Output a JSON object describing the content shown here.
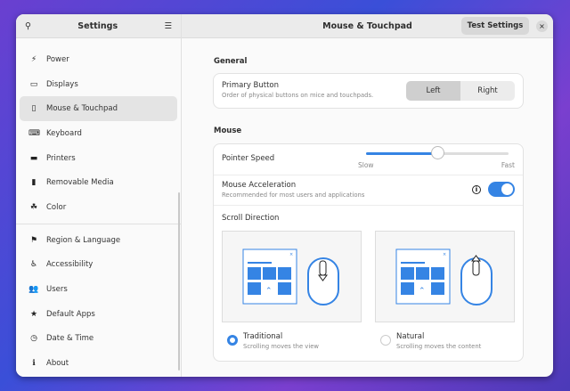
{
  "sidebar": {
    "title": "Settings",
    "search_icon": "search-icon",
    "menu_icon": "hamburger-menu-icon",
    "items": [
      {
        "label": "Power",
        "icon": "⚡"
      },
      {
        "label": "Displays",
        "icon": "▭"
      },
      {
        "label": "Mouse & Touchpad",
        "icon": "▯"
      },
      {
        "label": "Keyboard",
        "icon": "⌨"
      },
      {
        "label": "Printers",
        "icon": "▬"
      },
      {
        "label": "Removable Media",
        "icon": "▮"
      },
      {
        "label": "Color",
        "icon": "☘"
      }
    ],
    "items2": [
      {
        "label": "Region & Language",
        "icon": "⚑"
      },
      {
        "label": "Accessibility",
        "icon": "♿"
      },
      {
        "label": "Users",
        "icon": "👥"
      },
      {
        "label": "Default Apps",
        "icon": "★"
      },
      {
        "label": "Date & Time",
        "icon": "◷"
      },
      {
        "label": "About",
        "icon": "ℹ"
      }
    ]
  },
  "header": {
    "title": "Mouse & Touchpad",
    "test_button": "Test Settings",
    "close": "×"
  },
  "general": {
    "heading": "General",
    "primary_label": "Primary Button",
    "primary_sub": "Order of physical buttons on mice and touchpads.",
    "left": "Left",
    "right": "Right",
    "selected": "Left"
  },
  "mouse": {
    "heading": "Mouse",
    "speed_label": "Pointer Speed",
    "slow": "Slow",
    "fast": "Fast",
    "speed_value": 0.5,
    "accel_label": "Mouse Acceleration",
    "accel_sub": "Recommended for most users and applications",
    "accel_on": true,
    "scroll_label": "Scroll Direction",
    "traditional": "Traditional",
    "traditional_sub": "Scrolling moves the view",
    "natural": "Natural",
    "natural_sub": "Scrolling moves the content",
    "scroll_selected": "Traditional"
  },
  "colors": {
    "accent": "#3584e4"
  }
}
